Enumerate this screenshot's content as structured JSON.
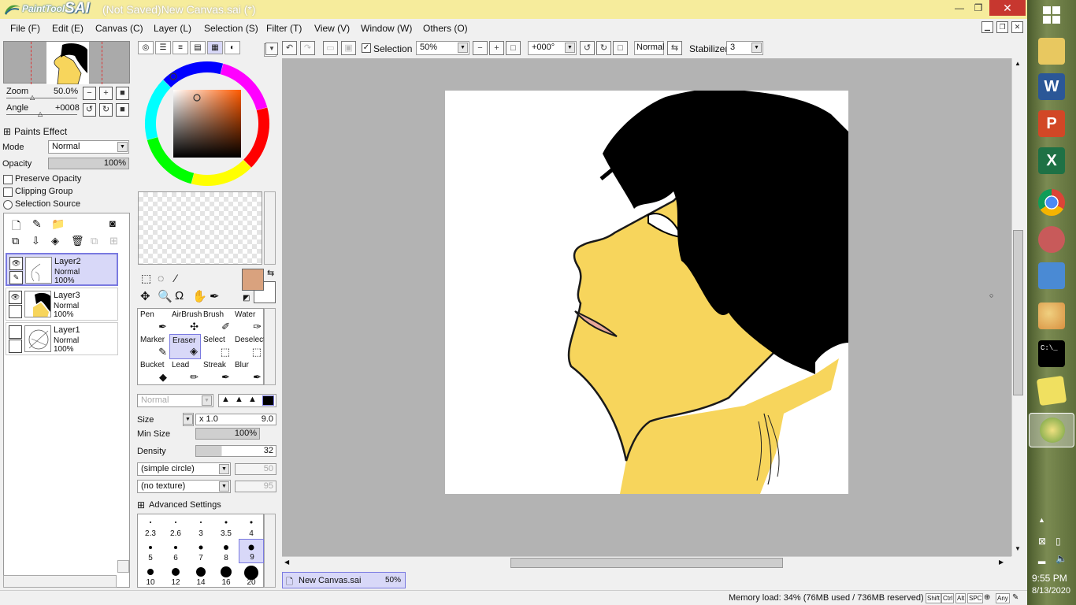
{
  "app": {
    "logo_text": "PaintTool",
    "logo_brand": "SAI",
    "title": "(Not Saved)New Canvas.sai (*)",
    "controls": {
      "minimize": "—",
      "restore": "❐",
      "close": "✕"
    }
  },
  "menu": [
    {
      "label": "File (F)"
    },
    {
      "label": "Edit (E)"
    },
    {
      "label": "Canvas (C)"
    },
    {
      "label": "Layer (L)"
    },
    {
      "label": "Selection (S)"
    },
    {
      "label": "Filter (T)"
    },
    {
      "label": "View (V)"
    },
    {
      "label": "Window (W)"
    },
    {
      "label": "Others (O)"
    }
  ],
  "navigator": {
    "zoom_label": "Zoom",
    "zoom_value": "50.0%",
    "angle_label": "Angle",
    "angle_value": "+0008"
  },
  "layer_props": {
    "paints_effect": "Paints Effect",
    "mode_label": "Mode",
    "mode_value": "Normal",
    "opacity_label": "Opacity",
    "opacity_value": "100%",
    "preserve_opacity": "Preserve Opacity",
    "clipping_group": "Clipping Group",
    "selection_source": "Selection Source"
  },
  "layers": [
    {
      "name": "Layer2",
      "mode": "Normal",
      "opacity": "100%",
      "selected": true
    },
    {
      "name": "Layer3",
      "mode": "Normal",
      "opacity": "100%",
      "selected": false
    },
    {
      "name": "Layer1",
      "mode": "Normal",
      "opacity": "100%",
      "selected": false
    }
  ],
  "colors": {
    "primary": "#d9a27e",
    "secondary": "#ffffff",
    "accent_selection": "#d8d8f8"
  },
  "tools": [
    {
      "label": "Pen"
    },
    {
      "label": "AirBrush"
    },
    {
      "label": "Brush"
    },
    {
      "label": "Water"
    },
    {
      "label": "Marker"
    },
    {
      "label": "Eraser",
      "selected": true
    },
    {
      "label": "Select"
    },
    {
      "label": "Deselect"
    },
    {
      "label": "Bucket"
    },
    {
      "label": "Lead"
    },
    {
      "label": "Streak"
    },
    {
      "label": "Blur"
    }
  ],
  "brush": {
    "blend_mode": "Normal",
    "size_label": "Size",
    "size_multiplier": "x 1.0",
    "size_value": "9.0",
    "min_size_label": "Min Size",
    "min_size_value": "100%",
    "density_label": "Density",
    "density_value": "32",
    "shape": "(simple circle)",
    "shape_value": "50",
    "texture": "(no texture)",
    "texture_value": "95",
    "advanced": "Advanced Settings"
  },
  "brush_sizes": [
    {
      "label": "2.3"
    },
    {
      "label": "2.6"
    },
    {
      "label": "3"
    },
    {
      "label": "3.5"
    },
    {
      "label": "4"
    },
    {
      "label": "5"
    },
    {
      "label": "6"
    },
    {
      "label": "7"
    },
    {
      "label": "8"
    },
    {
      "label": "9",
      "selected": true
    },
    {
      "label": "10"
    },
    {
      "label": "12"
    },
    {
      "label": "14"
    },
    {
      "label": "16"
    },
    {
      "label": "20"
    }
  ],
  "toolbar": {
    "selection_label": "Selection",
    "zoom_value": "50%",
    "angle_value": "+000°",
    "blend_value": "Normal",
    "stabilizer_label": "Stabilizer",
    "stabilizer_value": "3"
  },
  "document_tab": {
    "name": "New Canvas.sai",
    "zoom": "50%"
  },
  "status": {
    "memory": "Memory load: 34% (76MB used / 736MB reserved)",
    "keys": [
      "Shift",
      "Ctrl",
      "Alt",
      "SPC",
      "Any"
    ]
  },
  "taskbar": {
    "time": "9:55 PM",
    "date": "8/13/2020"
  }
}
